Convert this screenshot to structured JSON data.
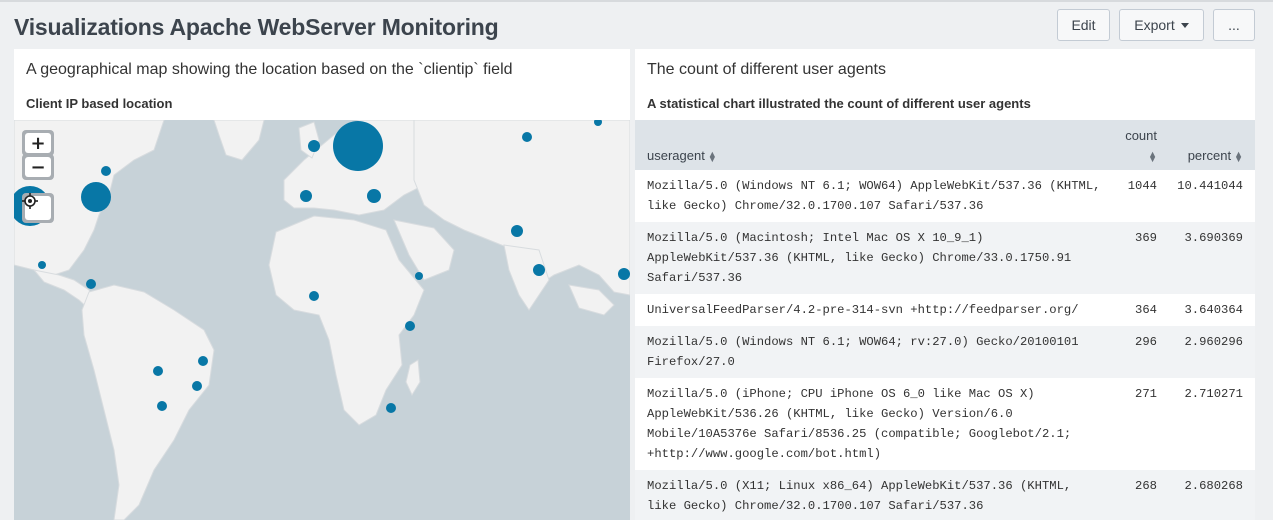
{
  "dashboard": {
    "title": "Visualizations Apache WebServer Monitoring",
    "edit_label": "Edit",
    "export_label": "Export",
    "more_label": "..."
  },
  "map_panel": {
    "heading": "A geographical map showing the location based on the `clientip` field",
    "subtitle": "Client IP based location",
    "zoom_in": "+",
    "zoom_out": "−",
    "marker_color": "#0877a6",
    "land_color": "#f2f2f2",
    "water_color": "#c7d2d8"
  },
  "table_panel": {
    "heading": "The count of different user agents",
    "subtitle": "A statistical chart illustrated the count of different user agents",
    "columns": {
      "useragent": "useragent",
      "count": "count",
      "percent": "percent"
    },
    "rows": [
      {
        "useragent": "Mozilla/5.0 (Windows NT 6.1; WOW64) AppleWebKit/537.36 (KHTML, like Gecko) Chrome/32.0.1700.107 Safari/537.36",
        "count": "1044",
        "percent": "10.441044"
      },
      {
        "useragent": "Mozilla/5.0 (Macintosh; Intel Mac OS X 10_9_1) AppleWebKit/537.36 (KHTML, like Gecko) Chrome/33.0.1750.91 Safari/537.36",
        "count": "369",
        "percent": "3.690369"
      },
      {
        "useragent": "UniversalFeedParser/4.2-pre-314-svn +http://feedparser.org/",
        "count": "364",
        "percent": "3.640364"
      },
      {
        "useragent": "Mozilla/5.0 (Windows NT 6.1; WOW64; rv:27.0) Gecko/20100101 Firefox/27.0",
        "count": "296",
        "percent": "2.960296"
      },
      {
        "useragent": "Mozilla/5.0 (iPhone; CPU iPhone OS 6_0 like Mac OS X) AppleWebKit/536.26 (KHTML, like Gecko) Version/6.0 Mobile/10A5376e Safari/8536.25 (compatible; Googlebot/2.1; +http://www.google.com/bot.html)",
        "count": "271",
        "percent": "2.710271"
      },
      {
        "useragent": "Mozilla/5.0 (X11; Linux x86_64) AppleWebKit/537.36 (KHTML, like Gecko) Chrome/32.0.1700.107 Safari/537.36",
        "count": "268",
        "percent": "2.680268"
      }
    ]
  }
}
